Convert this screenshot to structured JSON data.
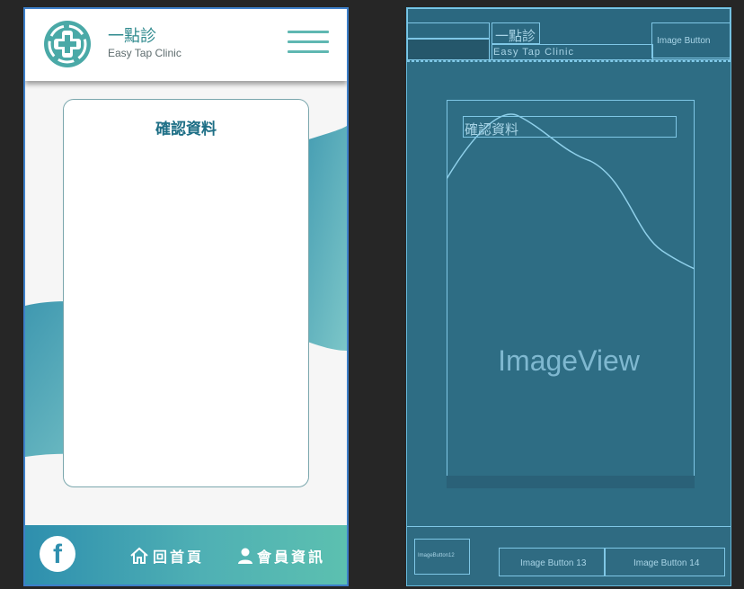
{
  "design": {
    "brand": {
      "title": "一點診",
      "subtitle": "Easy Tap Clinic"
    },
    "card": {
      "title": "確認資料"
    },
    "footer": {
      "facebook_glyph": "f",
      "home_label": "回首頁",
      "member_label": "會員資訊"
    },
    "colors": {
      "accent": "#2f8a8e",
      "teal": "#4fb0b4",
      "card_title": "#1e6f86"
    }
  },
  "blueprint": {
    "toolbar_title": "一點診",
    "toolbar_subtitle": "Easy Tap Clinic",
    "toolbar_button": "Image Button",
    "card_title": "確認資料",
    "image_view": "ImageView",
    "footer_button_left": "ImageButton12",
    "footer_button_13": "Image Button 13",
    "footer_button_14": "Image Button 14"
  }
}
